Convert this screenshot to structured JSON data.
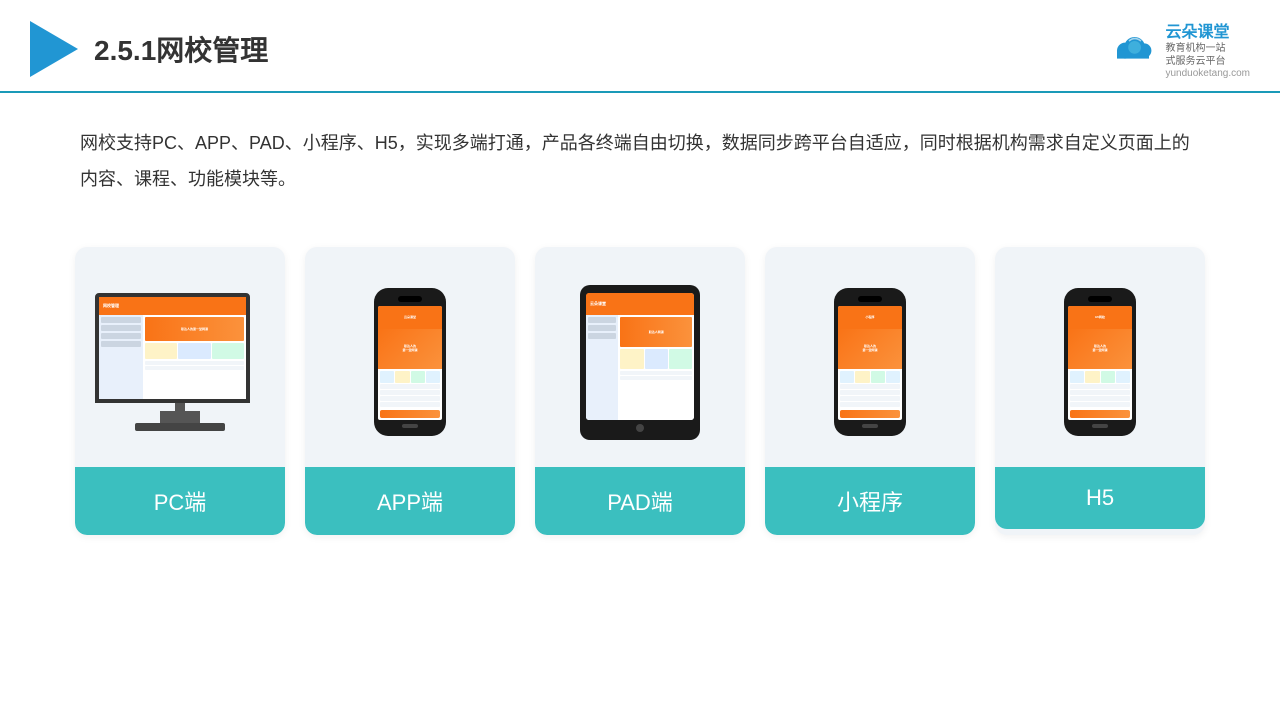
{
  "header": {
    "title": "2.5.1网校管理",
    "brand": {
      "name": "云朵课堂",
      "url": "yunduoketang.com",
      "slogan": "教育机构一站\n式服务云平台"
    }
  },
  "description": "网校支持PC、APP、PAD、小程序、H5，实现多端打通，产品各终端自由切换，数据同步跨平台自适应，同时根据机构需求自定义页面上的内容、课程、功能模块等。",
  "cards": [
    {
      "id": "pc",
      "label": "PC端",
      "type": "pc"
    },
    {
      "id": "app",
      "label": "APP端",
      "type": "phone"
    },
    {
      "id": "pad",
      "label": "PAD端",
      "type": "tablet"
    },
    {
      "id": "miniapp",
      "label": "小程序",
      "type": "phone2"
    },
    {
      "id": "h5",
      "label": "H5",
      "type": "phone3"
    }
  ],
  "colors": {
    "accent": "#3bbfbf",
    "header_line": "#1a9ab8",
    "logo_blue": "#2196d3",
    "title_color": "#333333"
  }
}
